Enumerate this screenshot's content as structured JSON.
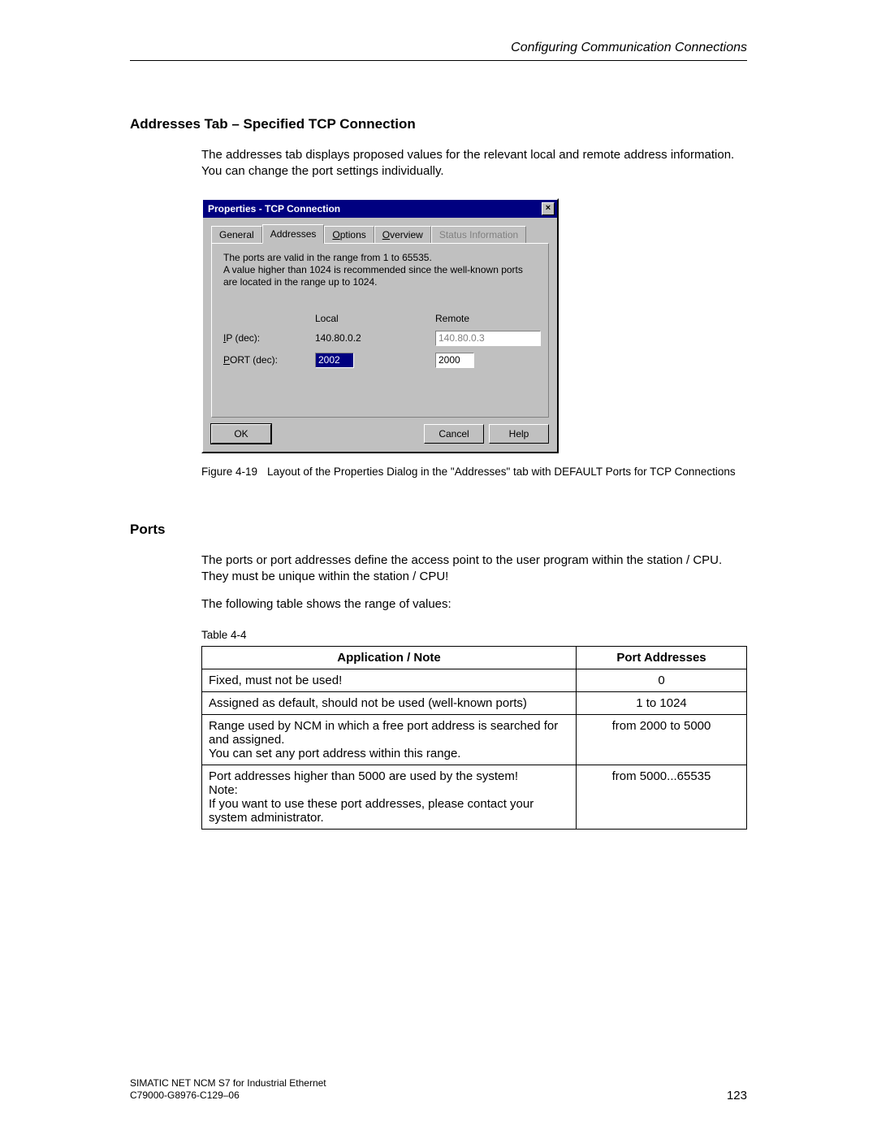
{
  "header": {
    "running_title": "Configuring Communication Connections"
  },
  "section1": {
    "heading": "Addresses Tab – Specified TCP Connection",
    "para1": "The addresses tab displays proposed values for the relevant local and remote address information. You can change the port settings individually."
  },
  "dialog": {
    "title": "Properties - TCP Connection",
    "close_glyph": "×",
    "tabs": {
      "general": "General",
      "addresses": "Addresses",
      "options_prefix": "O",
      "options_rest": "ptions",
      "overview_prefix": "O",
      "overview_rest": "verview",
      "status": "Status Information"
    },
    "help_text": "The ports are valid in the range from 1 to 65535.\nA value higher than 1024 is recommended since the well-known ports are located in the range up to 1024.",
    "col_local": "Local",
    "col_remote": "Remote",
    "row_ip_label_prefix": "I",
    "row_ip_label_rest": "P (dec):",
    "row_port_label_prefix": "P",
    "row_port_label_rest": "ORT (dec):",
    "ip_local": "140.80.0.2",
    "ip_remote": "140.80.0.3",
    "port_local": "2002",
    "port_remote": "2000",
    "buttons": {
      "ok": "OK",
      "cancel": "Cancel",
      "help": "Help"
    }
  },
  "figure": {
    "label": "Figure 4-19",
    "text": "Layout of the Properties Dialog in the \"Addresses\" tab with DEFAULT Ports for TCP Connections"
  },
  "section2": {
    "heading": "Ports",
    "para1": "The ports or port addresses define the access point to the user program within the station / CPU. They must be unique within the station / CPU!",
    "para2": "The following table shows the range of values:"
  },
  "table": {
    "caption": "Table 4-4",
    "headers": {
      "app": "Application / Note",
      "port": "Port Addresses"
    },
    "rows": [
      {
        "app": "Fixed, must not be used!",
        "port": "0"
      },
      {
        "app": "Assigned as default, should not be used (well-known ports)",
        "port": "1 to 1024"
      },
      {
        "app": "Range used by NCM in which a free port address is searched for and assigned.\nYou can set any port address within this range.",
        "port": "from 2000 to 5000"
      },
      {
        "app": "Port addresses higher than 5000 are used by the system!\nNote:\nIf you want to use these port addresses, please contact your system administrator.",
        "port": "from 5000...65535"
      }
    ]
  },
  "footer": {
    "line1": "SIMATIC NET NCM S7 for Industrial Ethernet",
    "line2": "C79000-G8976-C129–06",
    "page": "123"
  }
}
